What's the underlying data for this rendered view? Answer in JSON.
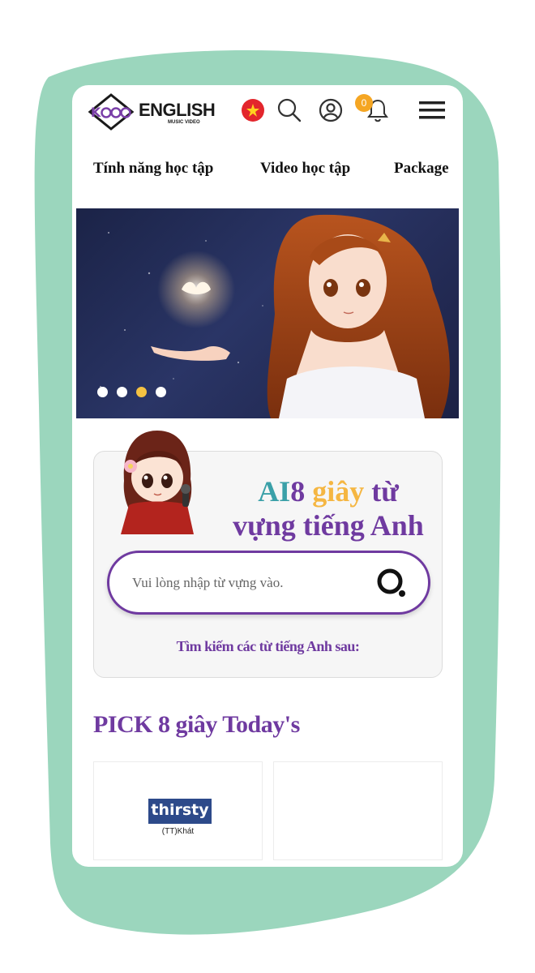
{
  "header": {
    "logo_text": "ENGLISH",
    "logo_sub": "MUSIC VIDEO",
    "notification_count": "0"
  },
  "nav": {
    "items": [
      {
        "label": "Tính năng học tập"
      },
      {
        "label": "Video học tập"
      },
      {
        "label": "Package"
      }
    ]
  },
  "banner": {
    "slide_count": 4,
    "active_slide": 3
  },
  "search_card": {
    "title_part1": "AI",
    "title_part2": "8",
    "title_part3": "giây",
    "title_part4": "từ",
    "title_line2": "vựng tiếng Anh",
    "placeholder": "Vui lòng nhập từ vựng vào.",
    "hint": "Tìm kiếm các từ tiếng Anh sau:"
  },
  "pick": {
    "title": "PICK 8 giây Today's",
    "cards": [
      {
        "word": "thirsty",
        "meaning": "(TT)Khát"
      },
      {
        "word": "",
        "meaning": ""
      }
    ]
  },
  "colors": {
    "accent_purple": "#6f3aa0",
    "teal": "#3aa0a8",
    "yellow": "#f5b642",
    "blob_green": "#9bd6bd",
    "badge_orange": "#f5a623"
  }
}
